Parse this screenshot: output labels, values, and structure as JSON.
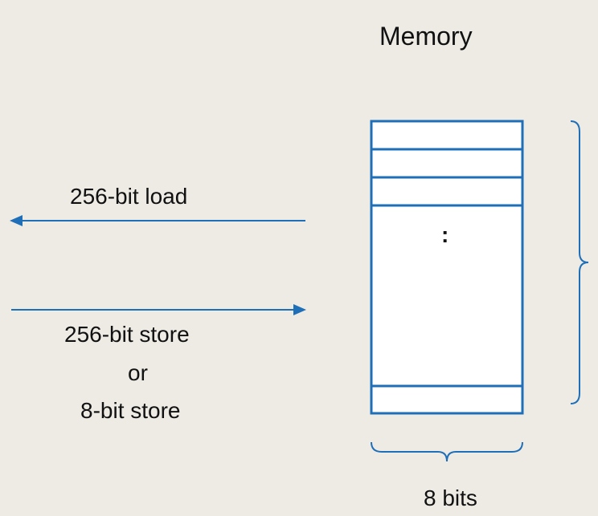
{
  "title": "Memory",
  "load_label": "256-bit load",
  "store_label_line1": "256-bit store",
  "store_label_line2": "or",
  "store_label_line3": "8-bit store",
  "width_label": "8 bits",
  "ellipsis": ":",
  "colors": {
    "background": "#eeebe5",
    "accent": "#1f6fb8",
    "text": "#111111"
  }
}
